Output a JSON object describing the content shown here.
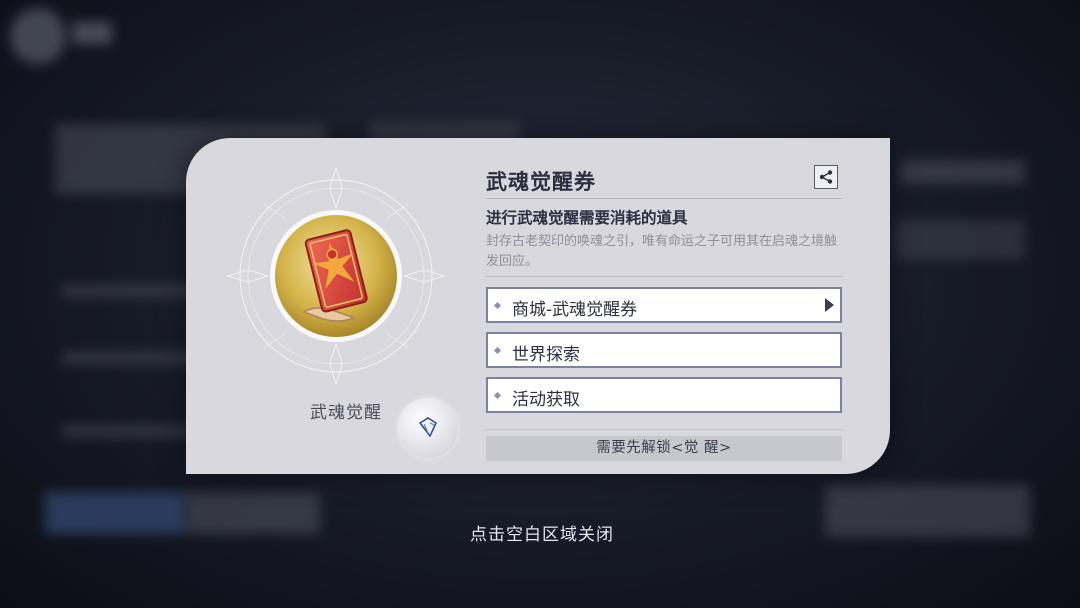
{
  "item": {
    "name": "武魂觉醒",
    "title": "武魂觉醒券",
    "subtitle": "进行武魂觉醒需要消耗的道具",
    "description": "封存古老契印的唤魂之引，唯有命运之子可用其在启魂之境触发回应。"
  },
  "sources": [
    {
      "label": "商城-武魂觉醒券",
      "has_arrow": true
    },
    {
      "label": "世界探索",
      "has_arrow": false
    },
    {
      "label": "活动获取",
      "has_arrow": false
    }
  ],
  "unlock_text": "需要先解锁<觉 醒>",
  "close_hint": "点击空白区域关闭",
  "icons": {
    "item_badge": "awakening-ticket-icon",
    "share": "share-icon",
    "source_marker": "diamond-bullet-icon",
    "goto": "chevron-right-icon",
    "gem": "gem-icon"
  },
  "colors": {
    "dialog_bg": "#d9d8de",
    "badge_gold": "#d4b44a",
    "ticket_red": "#d9453b",
    "source_border": "#7d80a0"
  }
}
